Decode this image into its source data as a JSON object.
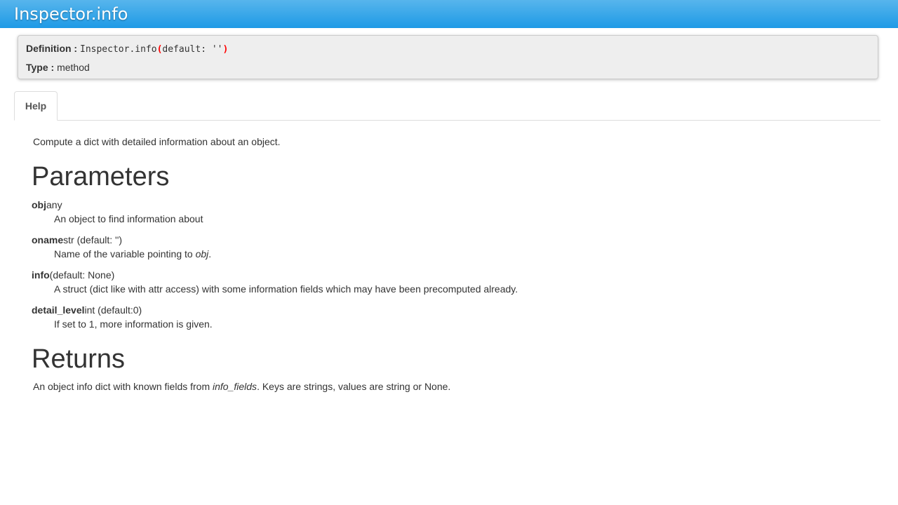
{
  "window": {
    "title": "Inspector.info"
  },
  "definition": {
    "label": "Definition :",
    "name": "Inspector.info",
    "open_paren": "(",
    "args": "default: ''",
    "close_paren": ")"
  },
  "type_info": {
    "label": "Type :",
    "value": "method"
  },
  "tabs": [
    {
      "label": "Help",
      "active": true
    }
  ],
  "help": {
    "summary": "Compute a dict with detailed information about an object.",
    "parameters_heading": "Parameters",
    "parameters": [
      {
        "name": "obj",
        "type": "any",
        "description": "An object to find information about"
      },
      {
        "name": "oname",
        "type": "str (default: '')",
        "description_prefix": "Name of the variable pointing to ",
        "description_em": "obj",
        "description_suffix": "."
      },
      {
        "name": "info",
        "type": "(default: None)",
        "description": "A struct (dict like with attr access) with some information fields which may have been precomputed already."
      },
      {
        "name": "detail_level",
        "type": "int (default:0)",
        "description": "If set to 1, more information is given."
      }
    ],
    "returns_heading": "Returns",
    "returns_prefix": "An object info dict with known fields from ",
    "returns_em": "info_fields",
    "returns_suffix": ". Keys are strings, values are string or None."
  }
}
